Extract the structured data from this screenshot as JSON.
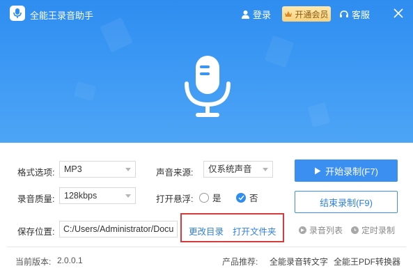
{
  "app": {
    "title": "全能王录音助手",
    "login_label": "登录",
    "vip_label": "开通会员",
    "service_label": "客服"
  },
  "form": {
    "format_label": "格式选项:",
    "format_value": "MP3",
    "quality_label": "录音质量:",
    "quality_value": "128kbps",
    "source_label": "声音来源:",
    "source_value": "仅系统声音",
    "float_label": "打开悬浮:",
    "float_yes": "是",
    "float_no": "否",
    "float_selected": "否",
    "save_label": "保存位置:",
    "save_path": "C:/Users/Administrator/Docu",
    "change_dir": "更改目录",
    "open_folder": "打开文件夹"
  },
  "actions": {
    "start": "开始录制(F7)",
    "stop": "结束录制(F9)",
    "record_list": "录音列表",
    "scheduled": "定时录制"
  },
  "footer": {
    "version_label": "当前版本:",
    "version_value": "2.0.0.1",
    "recommend_label": "产品推荐:",
    "product1": "全能录音转文字",
    "product2": "全能王PDF转换器"
  },
  "colors": {
    "primary": "#3b8ff1",
    "highlight_border": "#d63a3a",
    "vip_bg": "#f8d27e"
  }
}
